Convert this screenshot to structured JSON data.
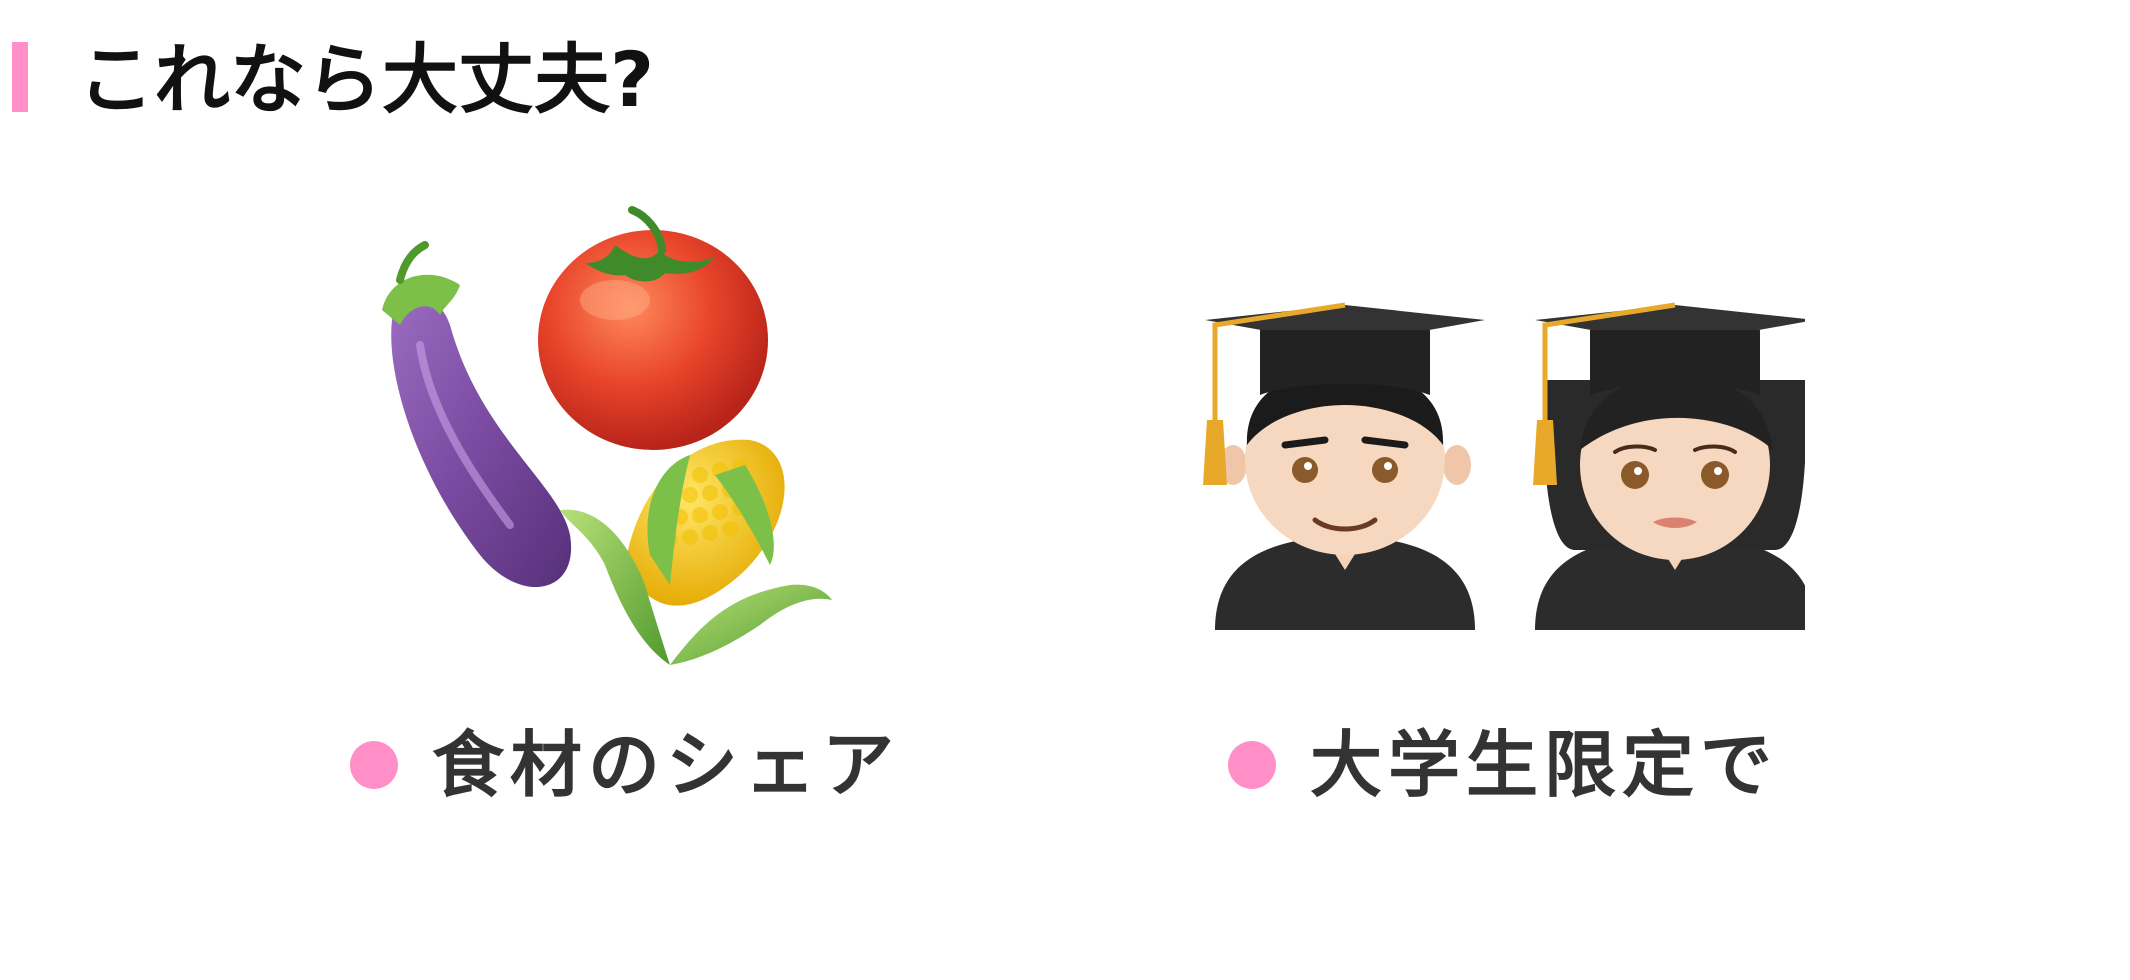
{
  "slide": {
    "title": "これなら大丈夫?",
    "accent_color": "#ff8fc6"
  },
  "items": [
    {
      "label": "食材のシェア",
      "icons": [
        "eggplant-icon",
        "tomato-icon",
        "corn-icon"
      ]
    },
    {
      "label": "大学生限定で",
      "icons": [
        "male-student-icon",
        "female-student-icon"
      ]
    }
  ]
}
